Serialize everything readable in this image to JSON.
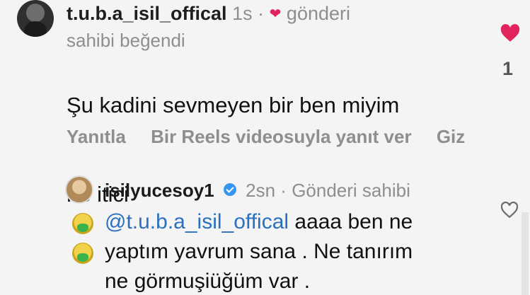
{
  "comment": {
    "username": "t.u.b.a_isil_offical",
    "time": "1s",
    "separator": "·",
    "author_liked_line1": "gönderi",
    "author_liked_line2": "sahibi beğendi",
    "text_line1": "Şu kadini sevmeyen bir ben miyim",
    "text_line2": "ne itici",
    "like_count": "1",
    "actions": [
      "Yanıtla",
      "Bir Reels videosuyla yanıt ver",
      "Giz"
    ]
  },
  "reply": {
    "username": "isilyucesoy1",
    "time": "2sn",
    "separator": "·",
    "badge": "Gönderi sahibi",
    "mention": "@t.u.b.a_isil_offical",
    "text_part1": " aaaa ben ne",
    "text_line2": "yaptım yavrum sana . Ne tanırım",
    "text_line3": "ne görmuşiüğüm var ."
  },
  "colors": {
    "like_red": "#e0245e",
    "mention_blue": "#2b6fbf",
    "muted_gray": "#8e8e8e",
    "verified_blue": "#3797f0"
  },
  "icons": [
    "heart-filled-icon",
    "heart-outline-icon",
    "verified-badge-icon",
    "vomit-emoji-icon"
  ]
}
